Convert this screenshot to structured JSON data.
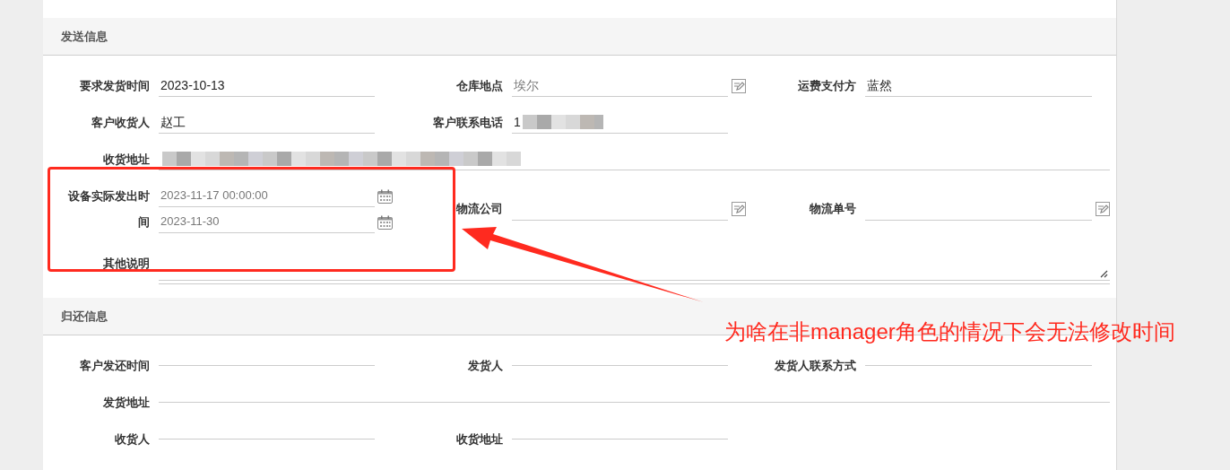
{
  "sections": [
    {
      "title": "发送信息",
      "rows": [
        [
          {
            "label": "要求发货时间",
            "kind": "text",
            "value": "2023-10-13",
            "disabled": false
          },
          {
            "label": "仓库地点",
            "kind": "text",
            "value": "埃尔",
            "disabled": true,
            "edit_button": true
          },
          {
            "label": "运费支付方",
            "kind": "text",
            "value": "蓝然",
            "disabled": false
          }
        ],
        [
          {
            "label": "客户收货人",
            "kind": "text",
            "value": "赵工",
            "disabled": false
          },
          {
            "label": "客户联系电话",
            "kind": "text",
            "value": "1",
            "disabled": false,
            "redacted": true
          }
        ],
        [
          {
            "label": "收货地址",
            "kind": "text",
            "wide": true,
            "redacted": true
          }
        ],
        [
          {
            "label": "设备实际发出时间",
            "kind": "date",
            "values": [
              "2023-11-17 00:00:00",
              "2023-11-30"
            ],
            "disabled": true
          },
          {
            "label": "物流公司",
            "kind": "text",
            "edit_button": true
          },
          {
            "label": "物流单号",
            "kind": "text",
            "edit_button": true
          }
        ],
        [
          {
            "label": "其他说明",
            "kind": "textarea",
            "wide": true
          }
        ]
      ]
    },
    {
      "title": "归还信息",
      "rows": [
        [
          {
            "label": "客户发还时间",
            "kind": "line"
          },
          {
            "label": "发货人",
            "kind": "line"
          },
          {
            "label": "发货人联系方式",
            "kind": "line"
          }
        ],
        [
          {
            "label": "发货地址",
            "kind": "line",
            "wide": true
          }
        ],
        [
          {
            "label": "收货人",
            "kind": "line"
          },
          {
            "label": "收货地址",
            "kind": "line"
          }
        ]
      ]
    }
  ],
  "annotation": {
    "text": "为啥在非manager角色的情况下会无法修改时间"
  }
}
